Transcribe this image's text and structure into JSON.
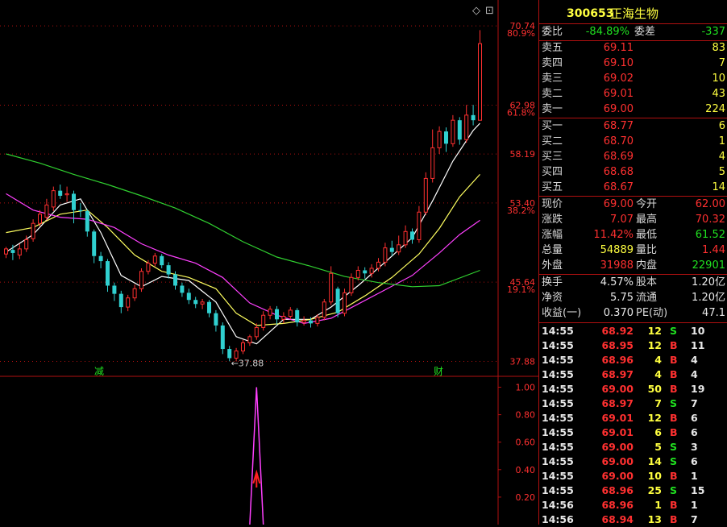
{
  "stock": {
    "code": "300653",
    "name": "正海生物"
  },
  "colors": {
    "up": "#ff3030",
    "down": "#30d0d0",
    "ma5": "#ffffff",
    "ma10": "#ffff60",
    "ma20": "#ff40ff",
    "ma60": "#30d030",
    "grid": "#b01010"
  },
  "chart": {
    "top_icons": [
      "◇",
      "⊡"
    ],
    "price_labels": [
      "70.74",
      "62.98",
      "58.19",
      "53.40",
      "45.64",
      "37.88"
    ],
    "pct_labels": [
      "80.9%",
      "61.8%",
      "38.2%",
      "19.1%"
    ],
    "low_marker": "←37.88",
    "event_markers": [
      "减",
      "财"
    ],
    "indicator_labels": [
      "1.00",
      "0.80",
      "0.60",
      "0.40",
      "0.20"
    ]
  },
  "chart_data": {
    "type": "candlestick",
    "ylim": [
      36.5,
      72.8
    ],
    "bars": [
      [
        48.4,
        48.9,
        49.1,
        48.0
      ],
      [
        48.8,
        48.5,
        49.3,
        47.8
      ],
      [
        48.3,
        48.9,
        49.4,
        47.9
      ],
      [
        48.9,
        49.8,
        50.2,
        48.6
      ],
      [
        49.9,
        51.4,
        51.8,
        49.6
      ],
      [
        51.4,
        52.3,
        52.7,
        51.1
      ],
      [
        52.0,
        53.2,
        53.8,
        51.7
      ],
      [
        53.0,
        54.6,
        55.0,
        52.6
      ],
      [
        54.6,
        54.1,
        55.2,
        53.8
      ],
      [
        54.2,
        54.3,
        55.0,
        53.5
      ],
      [
        54.3,
        52.7,
        54.6,
        51.4
      ],
      [
        52.7,
        52.6,
        53.4,
        52.0
      ],
      [
        52.6,
        50.6,
        52.8,
        50.1
      ],
      [
        50.6,
        48.2,
        50.8,
        47.5
      ],
      [
        48.2,
        47.7,
        48.6,
        47.0
      ],
      [
        47.7,
        45.3,
        47.9,
        44.7
      ],
      [
        45.3,
        44.5,
        45.6,
        43.8
      ],
      [
        44.5,
        43.2,
        44.8,
        42.6
      ],
      [
        43.2,
        44.1,
        44.4,
        42.8
      ],
      [
        44.1,
        45.0,
        45.4,
        43.8
      ],
      [
        45.0,
        46.7,
        47.0,
        44.7
      ],
      [
        46.7,
        47.5,
        47.8,
        46.4
      ],
      [
        47.5,
        48.2,
        48.5,
        47.2
      ],
      [
        48.2,
        47.3,
        48.4,
        47.0
      ],
      [
        47.3,
        46.4,
        47.6,
        46.0
      ],
      [
        46.4,
        45.3,
        46.7,
        44.9
      ],
      [
        45.3,
        44.6,
        45.6,
        44.2
      ],
      [
        44.6,
        43.9,
        45.0,
        43.5
      ],
      [
        43.9,
        43.5,
        44.2,
        43.1
      ],
      [
        43.5,
        43.7,
        44.0,
        43.0
      ],
      [
        43.7,
        42.6,
        43.9,
        42.2
      ],
      [
        42.6,
        41.4,
        42.9,
        40.8
      ],
      [
        41.4,
        39.1,
        41.7,
        38.6
      ],
      [
        39.1,
        38.2,
        39.4,
        37.9
      ],
      [
        38.2,
        38.9,
        39.2,
        37.88
      ],
      [
        38.9,
        39.7,
        40.0,
        38.6
      ],
      [
        39.7,
        40.3,
        40.5,
        39.4
      ],
      [
        40.3,
        41.2,
        41.6,
        40.0
      ],
      [
        41.2,
        42.4,
        42.8,
        40.9
      ],
      [
        42.4,
        43.0,
        43.3,
        42.0
      ],
      [
        43.0,
        42.0,
        43.3,
        41.5
      ],
      [
        42.0,
        42.3,
        42.7,
        41.6
      ],
      [
        42.3,
        42.9,
        43.2,
        42.0
      ],
      [
        42.9,
        41.7,
        43.1,
        41.3
      ],
      [
        41.7,
        41.9,
        42.3,
        41.4
      ],
      [
        41.9,
        41.6,
        42.2,
        41.2
      ],
      [
        41.6,
        42.2,
        42.5,
        41.3
      ],
      [
        42.2,
        43.7,
        44.0,
        41.9
      ],
      [
        43.7,
        46.5,
        47.2,
        43.4
      ],
      [
        45.0,
        42.6,
        45.2,
        42.2
      ],
      [
        42.6,
        44.6,
        45.0,
        42.3
      ],
      [
        44.6,
        46.1,
        46.5,
        44.3
      ],
      [
        46.1,
        46.8,
        47.2,
        45.8
      ],
      [
        46.8,
        46.5,
        47.1,
        46.0
      ],
      [
        46.5,
        47.0,
        47.4,
        46.1
      ],
      [
        47.0,
        47.6,
        48.0,
        46.7
      ],
      [
        47.6,
        49.0,
        49.5,
        47.2
      ],
      [
        49.0,
        48.6,
        49.7,
        48.2
      ],
      [
        48.6,
        49.3,
        50.2,
        48.3
      ],
      [
        49.3,
        50.6,
        51.2,
        49.0
      ],
      [
        50.6,
        49.8,
        50.9,
        49.4
      ],
      [
        49.8,
        52.5,
        53.1,
        49.5
      ],
      [
        52.5,
        55.8,
        56.4,
        52.2
      ],
      [
        55.8,
        58.8,
        60.6,
        55.4
      ],
      [
        58.8,
        60.4,
        60.9,
        58.2
      ],
      [
        60.4,
        59.2,
        60.8,
        58.4
      ],
      [
        59.2,
        61.5,
        62.0,
        58.9
      ],
      [
        61.5,
        59.6,
        61.8,
        59.1
      ],
      [
        59.6,
        62.0,
        63.0,
        59.3
      ],
      [
        62.0,
        61.5,
        63.0,
        61.0
      ],
      [
        61.5,
        69.0,
        70.32,
        61.52
      ]
    ],
    "ma": {
      "MA5": [
        [
          0,
          48.6
        ],
        [
          4,
          50.3
        ],
        [
          8,
          53.2
        ],
        [
          11,
          53.8
        ],
        [
          14,
          50.5
        ],
        [
          17,
          46.3
        ],
        [
          20,
          45.2
        ],
        [
          23,
          46.2
        ],
        [
          27,
          45.8
        ],
        [
          31,
          43.7
        ],
        [
          34,
          40.3
        ],
        [
          37,
          39.6
        ],
        [
          41,
          42.0
        ],
        [
          45,
          42.0
        ],
        [
          48,
          43.2
        ],
        [
          52,
          45.3
        ],
        [
          56,
          47.6
        ],
        [
          60,
          50.0
        ],
        [
          63,
          53.6
        ],
        [
          66,
          57.5
        ],
        [
          69,
          60.5
        ],
        [
          70,
          61.2
        ]
      ],
      "MA10": [
        [
          0,
          50.5
        ],
        [
          4,
          51.0
        ],
        [
          8,
          52.3
        ],
        [
          12,
          52.7
        ],
        [
          15,
          51.0
        ],
        [
          19,
          48.3
        ],
        [
          23,
          46.7
        ],
        [
          27,
          46.1
        ],
        [
          31,
          45.0
        ],
        [
          34,
          42.6
        ],
        [
          37,
          41.4
        ],
        [
          41,
          41.6
        ],
        [
          45,
          42.0
        ],
        [
          49,
          42.7
        ],
        [
          53,
          44.3
        ],
        [
          57,
          46.1
        ],
        [
          61,
          48.4
        ],
        [
          64,
          50.9
        ],
        [
          67,
          54.0
        ],
        [
          70,
          56.2
        ]
      ],
      "MA20": [
        [
          0,
          54.3
        ],
        [
          4,
          52.7
        ],
        [
          8,
          52.0
        ],
        [
          12,
          51.8
        ],
        [
          16,
          51.0
        ],
        [
          20,
          49.4
        ],
        [
          24,
          48.3
        ],
        [
          28,
          47.5
        ],
        [
          32,
          46.1
        ],
        [
          36,
          43.6
        ],
        [
          40,
          42.4
        ],
        [
          44,
          41.6
        ],
        [
          48,
          42.1
        ],
        [
          52,
          43.5
        ],
        [
          56,
          44.9
        ],
        [
          60,
          46.3
        ],
        [
          64,
          48.5
        ],
        [
          67,
          50.3
        ],
        [
          70,
          51.7
        ]
      ],
      "MA60": [
        [
          0,
          58.2
        ],
        [
          5,
          57.3
        ],
        [
          10,
          56.2
        ],
        [
          15,
          55.2
        ],
        [
          20,
          54.1
        ],
        [
          25,
          52.9
        ],
        [
          30,
          51.4
        ],
        [
          35,
          49.6
        ],
        [
          40,
          48.1
        ],
        [
          45,
          47.2
        ],
        [
          50,
          46.2
        ],
        [
          55,
          45.6
        ],
        [
          60,
          45.2
        ],
        [
          64,
          45.3
        ],
        [
          70,
          46.8
        ]
      ]
    },
    "indicator": {
      "ylim": [
        0,
        1.05
      ],
      "spike": [
        [
          36,
          0
        ],
        [
          37,
          1.0
        ],
        [
          38,
          0
        ]
      ]
    }
  },
  "panel": {
    "weibi": {
      "label": "委比",
      "value": "-84.89%",
      "label2": "委差",
      "value2": "-337"
    },
    "sells": [
      {
        "label": "卖五",
        "price": "69.11",
        "vol": "83"
      },
      {
        "label": "卖四",
        "price": "69.10",
        "vol": "7"
      },
      {
        "label": "卖三",
        "price": "69.02",
        "vol": "10"
      },
      {
        "label": "卖二",
        "price": "69.01",
        "vol": "43"
      },
      {
        "label": "卖一",
        "price": "69.00",
        "vol": "224"
      }
    ],
    "buys": [
      {
        "label": "买一",
        "price": "68.77",
        "vol": "6"
      },
      {
        "label": "买二",
        "price": "68.70",
        "vol": "1"
      },
      {
        "label": "买三",
        "price": "68.69",
        "vol": "4"
      },
      {
        "label": "买四",
        "price": "68.68",
        "vol": "5"
      },
      {
        "label": "买五",
        "price": "68.67",
        "vol": "14"
      }
    ],
    "stats": [
      {
        "l1": "现价",
        "v1": "69.00",
        "c1": "red",
        "l2": "今开",
        "v2": "62.00",
        "c2": "red"
      },
      {
        "l1": "涨跌",
        "v1": "7.07",
        "c1": "red",
        "l2": "最高",
        "v2": "70.32",
        "c2": "red"
      },
      {
        "l1": "涨幅",
        "v1": "11.42%",
        "c1": "red",
        "l2": "最低",
        "v2": "61.52",
        "c2": "green"
      },
      {
        "l1": "总量",
        "v1": "54889",
        "c1": "yellow",
        "l2": "量比",
        "v2": "1.44",
        "c2": "red"
      },
      {
        "l1": "外盘",
        "v1": "31988",
        "c1": "red",
        "l2": "内盘",
        "v2": "22901",
        "c2": "green"
      }
    ],
    "info": [
      {
        "l1": "换手",
        "v1": "4.57%",
        "l2": "股本",
        "v2": "1.20亿"
      },
      {
        "l1": "净资",
        "v1": "5.75",
        "l2": "流通",
        "v2": "1.20亿"
      },
      {
        "l1": "收益(一)",
        "v1": "0.370",
        "l2": "PE(动)",
        "v2": "47.1"
      }
    ],
    "trades": [
      {
        "time": "14:55",
        "price": "68.92",
        "vol": "12",
        "side": "S",
        "n": "10"
      },
      {
        "time": "14:55",
        "price": "68.95",
        "vol": "12",
        "side": "B",
        "n": "11"
      },
      {
        "time": "14:55",
        "price": "68.96",
        "vol": "4",
        "side": "B",
        "n": "4"
      },
      {
        "time": "14:55",
        "price": "68.97",
        "vol": "4",
        "side": "B",
        "n": "4"
      },
      {
        "time": "14:55",
        "price": "69.00",
        "vol": "50",
        "side": "B",
        "n": "19"
      },
      {
        "time": "14:55",
        "price": "68.97",
        "vol": "7",
        "side": "S",
        "n": "7"
      },
      {
        "time": "14:55",
        "price": "69.01",
        "vol": "12",
        "side": "B",
        "n": "6"
      },
      {
        "time": "14:55",
        "price": "69.01",
        "vol": "6",
        "side": "B",
        "n": "6"
      },
      {
        "time": "14:55",
        "price": "69.00",
        "vol": "5",
        "side": "S",
        "n": "3"
      },
      {
        "time": "14:55",
        "price": "69.00",
        "vol": "14",
        "side": "S",
        "n": "6"
      },
      {
        "time": "14:55",
        "price": "69.00",
        "vol": "10",
        "side": "B",
        "n": "1"
      },
      {
        "time": "14:55",
        "price": "68.96",
        "vol": "25",
        "side": "S",
        "n": "15"
      },
      {
        "time": "14:56",
        "price": "68.96",
        "vol": "1",
        "side": "B",
        "n": "1"
      },
      {
        "time": "14:56",
        "price": "68.94",
        "vol": "13",
        "side": "B",
        "n": "7"
      }
    ]
  }
}
